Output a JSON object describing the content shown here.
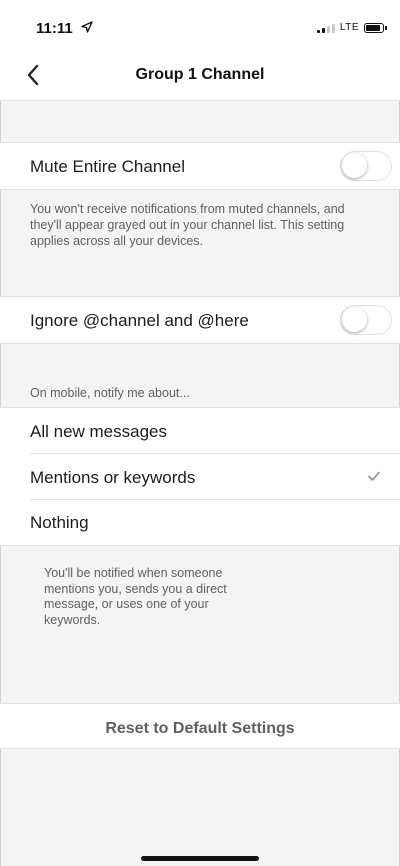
{
  "status_bar": {
    "time": "11:11",
    "network": "LTE"
  },
  "nav": {
    "title": "Group 1 Channel"
  },
  "mute": {
    "label": "Mute Entire Channel",
    "enabled": false,
    "description": "You won't receive notifications from muted channels, and they'll appear grayed out in your channel list. This setting applies across all your devices."
  },
  "ignore": {
    "label": "Ignore @channel and @here",
    "enabled": false
  },
  "notify": {
    "header": "On mobile, notify me about...",
    "options": [
      {
        "label": "All new messages",
        "selected": false
      },
      {
        "label": "Mentions or keywords",
        "selected": true
      },
      {
        "label": "Nothing",
        "selected": false
      }
    ],
    "note": "You'll be notified when someone mentions you, sends you a direct message, or uses one of your keywords."
  },
  "reset": {
    "label": "Reset to Default Settings"
  },
  "colors": {
    "background": "#f4f4f4",
    "text": "#1d1c1d",
    "muted_text": "#616061",
    "divider": "#e3e3e3"
  }
}
